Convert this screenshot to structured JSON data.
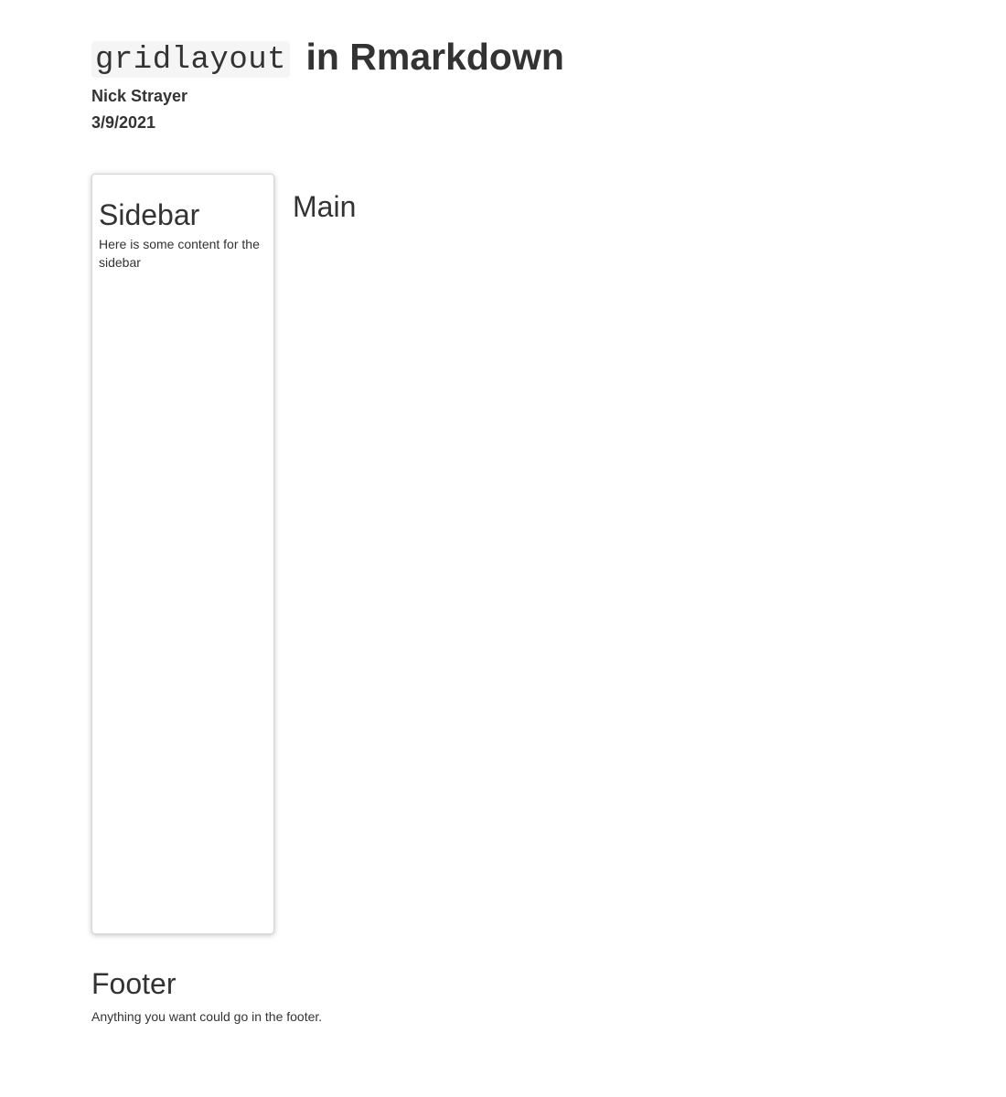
{
  "header": {
    "title_code": "gridlayout",
    "title_text": " in Rmarkdown",
    "author": "Nick Strayer",
    "date": "3/9/2021"
  },
  "sidebar": {
    "title": "Sidebar",
    "text": "Here is some content for the sidebar"
  },
  "main": {
    "title": "Main"
  },
  "footer": {
    "title": "Footer",
    "text": "Anything you want could go in the footer."
  }
}
